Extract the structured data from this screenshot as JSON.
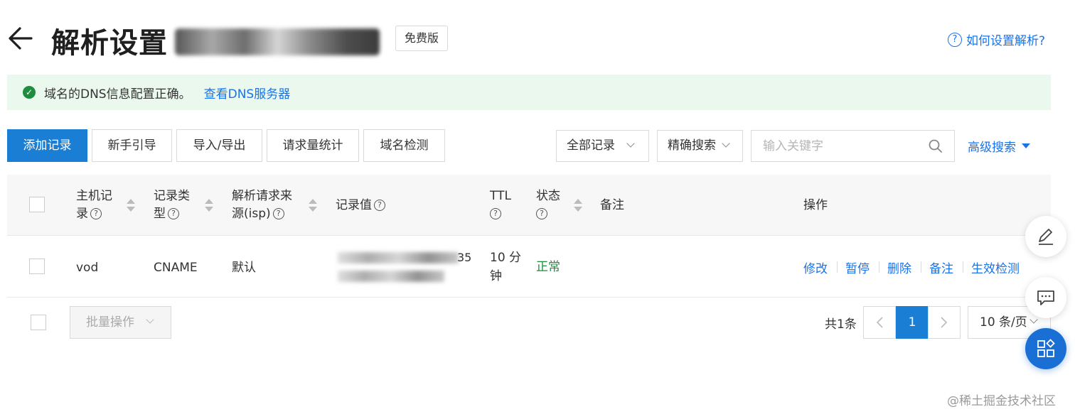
{
  "header": {
    "title": "解析设置",
    "badge": "免费版",
    "help_link": "如何设置解析?",
    "help_icon": "question-circle-icon"
  },
  "alert": {
    "message": "域名的DNS信息配置正确。",
    "link": "查看DNS服务器"
  },
  "toolbar": {
    "add_record": "添加记录",
    "guide": "新手引导",
    "import_export": "导入/导出",
    "request_stats": "请求量统计",
    "domain_check": "域名检测",
    "record_filter": "全部记录",
    "search_mode": "精确搜索",
    "search_placeholder": "输入关键字",
    "advanced_search": "高级搜索"
  },
  "table": {
    "headers": {
      "host_line1": "主机记",
      "host_line2": "录",
      "type_line1": "记录类",
      "type_line2": "型",
      "isp_line1": "解析请求来",
      "isp_line2": "源(isp)",
      "value": "记录值",
      "ttl": "TTL",
      "status": "状态",
      "remark": "备注",
      "actions": "操作"
    },
    "rows": [
      {
        "host": "vod",
        "type": "CNAME",
        "isp": "默认",
        "value_visible": "35",
        "ttl_line1": "10 分",
        "ttl_line2": "钟",
        "status": "正常",
        "actions": [
          "修改",
          "暂停",
          "删除",
          "备注",
          "生效检测"
        ]
      }
    ]
  },
  "footer": {
    "batch": "批量操作",
    "total": "共1条",
    "current_page": "1",
    "page_size": "10 条/页"
  },
  "watermark": "@稀土掘金技术社区",
  "colors": {
    "primary": "#1a7fd4",
    "link": "#1a73e8",
    "success": "#1e8e3e",
    "alert_bg": "#eaf8ee"
  }
}
